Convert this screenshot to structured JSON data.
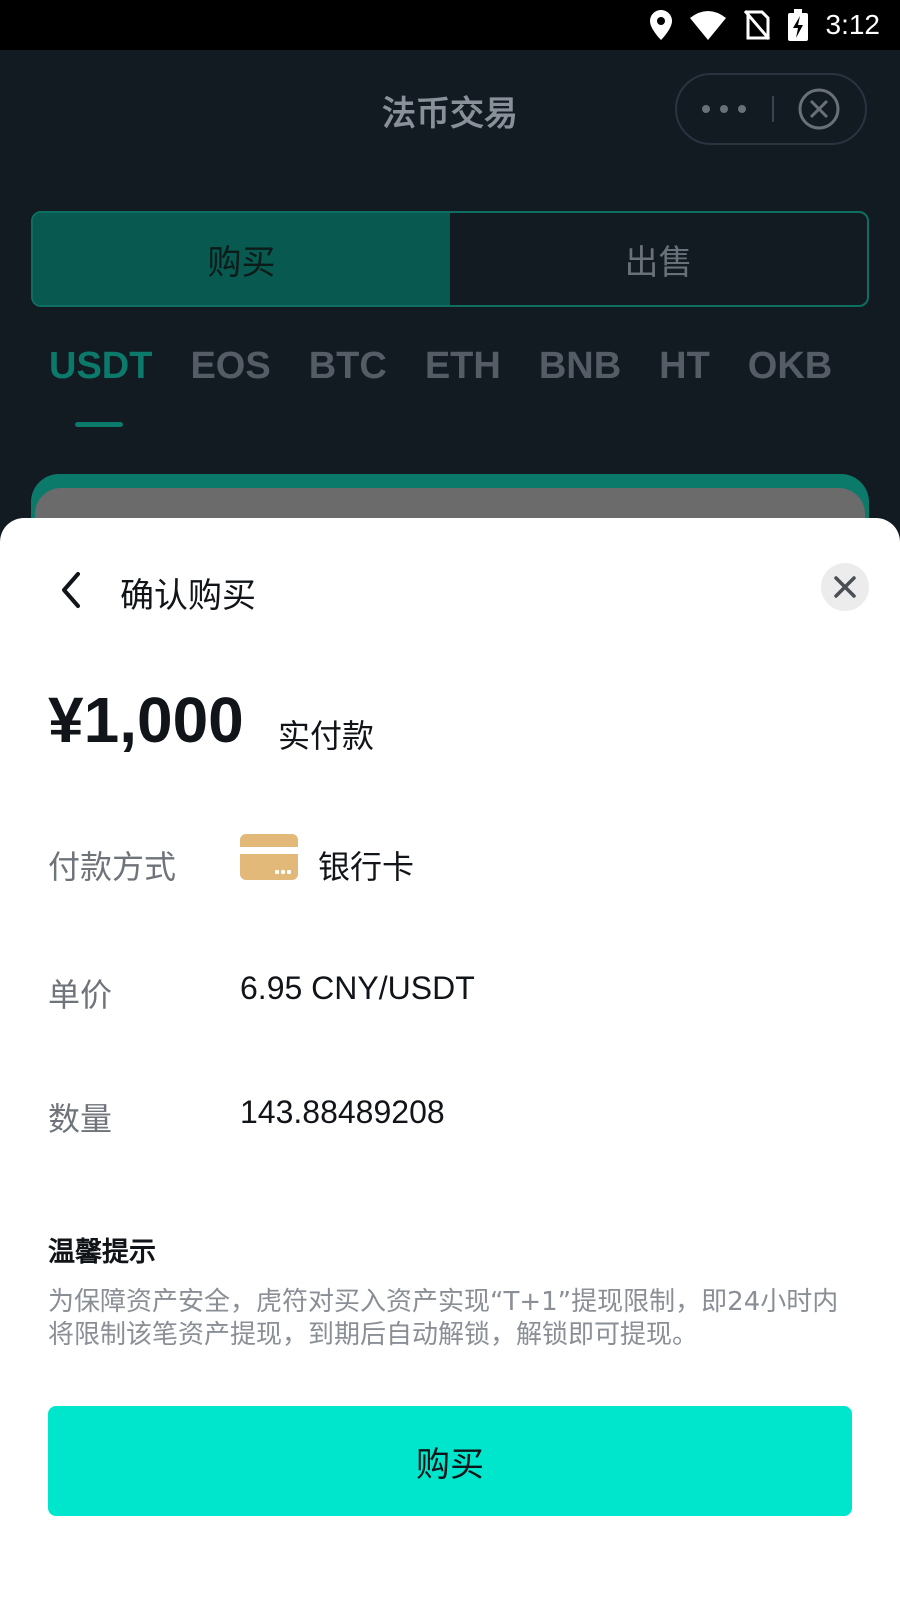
{
  "status_bar": {
    "time": "3:12",
    "icons": [
      "location-icon",
      "wifi-icon",
      "no-sim-icon",
      "battery-charging-icon"
    ]
  },
  "nav": {
    "title": "法币交易",
    "capsule_icons": [
      "more-icon",
      "close-circle-icon"
    ]
  },
  "trade_toggle": {
    "tabs": [
      {
        "label": "购买",
        "active": true
      },
      {
        "label": "出售",
        "active": false
      }
    ]
  },
  "coin_tabs": {
    "items": [
      "USDT",
      "EOS",
      "BTC",
      "ETH",
      "BNB",
      "HT",
      "OKB"
    ],
    "active": "USDT"
  },
  "sheet": {
    "title": "确认购买",
    "amount": "¥1,000",
    "amount_label": "实付款",
    "payment_method": {
      "label": "付款方式",
      "value": "银行卡",
      "icon": "bank-card-icon"
    },
    "unit_price": {
      "label": "单价",
      "value": "6.95 CNY/USDT"
    },
    "quantity": {
      "label": "数量",
      "value": "143.88489208"
    },
    "tip_title": "温馨提示",
    "tip_text": "为保障资产安全，虎符对买入资产实现“T+1”提现限制，即24小时内将限制该笔资产提现，到期后自动解锁，解锁即可提现。",
    "buy_button": "购买"
  },
  "colors": {
    "accent": "#00e6cc",
    "active_tab_bg": "#085a51",
    "active_coin": "#0b7a6b",
    "card_icon": "#e3b97a"
  }
}
